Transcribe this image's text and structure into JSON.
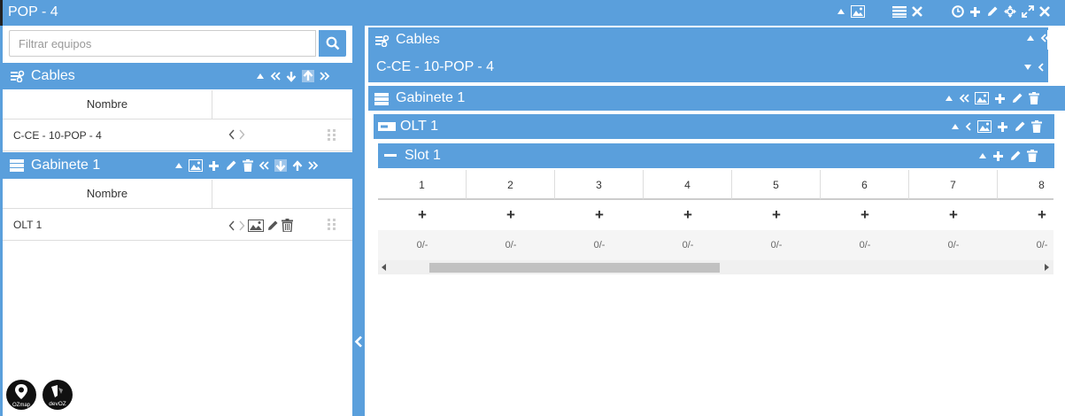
{
  "window": {
    "title": "POP - 4"
  },
  "search": {
    "placeholder": "Filtrar equipos"
  },
  "left": {
    "cables": {
      "title": "Cables",
      "column": "Nombre",
      "rows": [
        {
          "name": "C-CE - 10-POP - 4"
        }
      ]
    },
    "cabinet": {
      "title": "Gabinete 1",
      "column": "Nombre",
      "rows": [
        {
          "name": "OLT 1"
        }
      ]
    }
  },
  "logos": [
    {
      "label": "OZmap"
    },
    {
      "label": "devOZ"
    }
  ],
  "right": {
    "cables": {
      "title": "Cables",
      "item": "C-CE - 10-POP - 4"
    },
    "cabinet": {
      "title": "Gabinete 1"
    },
    "olt": {
      "title": "OLT 1"
    },
    "slot": {
      "title": "Slot 1",
      "ports": [
        {
          "number": "1",
          "add": "+",
          "status": "0/-"
        },
        {
          "number": "2",
          "add": "+",
          "status": "0/-"
        },
        {
          "number": "3",
          "add": "+",
          "status": "0/-"
        },
        {
          "number": "4",
          "add": "+",
          "status": "0/-"
        },
        {
          "number": "5",
          "add": "+",
          "status": "0/-"
        },
        {
          "number": "6",
          "add": "+",
          "status": "0/-"
        },
        {
          "number": "7",
          "add": "+",
          "status": "0/-"
        },
        {
          "number": "8",
          "add": "+",
          "status": "0/-"
        }
      ]
    }
  },
  "colors": {
    "accent": "#5a9fdc",
    "border": "#dddddd"
  }
}
